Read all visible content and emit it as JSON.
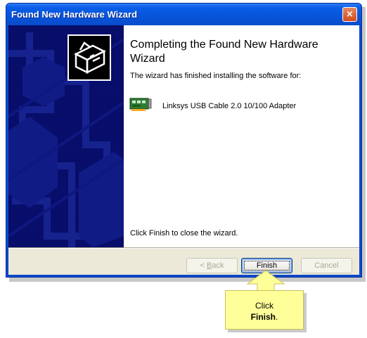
{
  "window": {
    "title": "Found New Hardware Wizard",
    "close_label": "×"
  },
  "wizard": {
    "heading": "Completing the Found New Hardware Wizard",
    "intro": "The wizard has finished installing the software for:",
    "device_name": "Linksys USB Cable 2.0 10/100 Adapter",
    "finish_note": "Click Finish to close the wizard."
  },
  "buttons": {
    "back_prefix": "< ",
    "back_mnemonic": "B",
    "back_rest": "ack",
    "finish": "Finish",
    "cancel": "Cancel"
  },
  "callout": {
    "line1": "Click",
    "line2_bold": "Finish",
    "line2_tail": "."
  },
  "colors": {
    "title_bar": "#0a5ee8",
    "side_panel": "#080e6d",
    "callout_bg": "#ffff99",
    "dialog_bg": "#ece9d8"
  },
  "icons": {
    "title_close": "close-icon",
    "side": "hardware-wizard-icon",
    "device": "network-adapter-icon",
    "callout_arrow": "arrow-up-icon"
  }
}
